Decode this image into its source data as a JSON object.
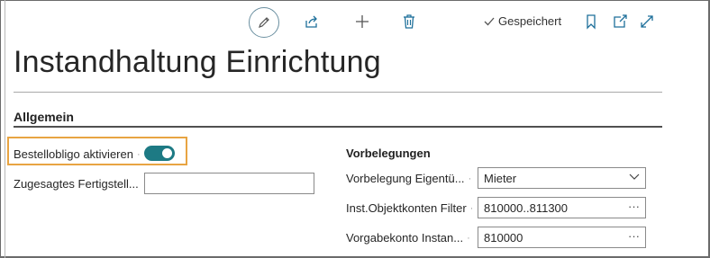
{
  "toolbar": {
    "edit_icon": "pencil-icon",
    "share_icon": "share-icon",
    "new_icon": "plus-icon",
    "delete_icon": "trash-icon",
    "saved_label": "Gespeichert",
    "bookmark_icon": "bookmark-icon",
    "open_new_icon": "open-in-new-window-icon",
    "expand_icon": "expand-icon"
  },
  "page": {
    "title": "Instandhaltung Einrichtung"
  },
  "section": {
    "title": "Allgemein"
  },
  "left_fields": {
    "bestellobligo": {
      "label": "Bestellobligo aktivieren",
      "value": true
    },
    "fertigstellung": {
      "label": "Zugesagtes Fertigstell...",
      "value": ""
    }
  },
  "right_fields": {
    "heading": "Vorbelegungen",
    "eigentuemer": {
      "label": "Vorbelegung Eigentü...",
      "value": "Mieter"
    },
    "objektkonten": {
      "label": "Inst.Objektkonten Filter",
      "value": "810000..811300"
    },
    "vorgabekonto": {
      "label": "Vorgabekonto Instan...",
      "value": "810000"
    }
  },
  "colors": {
    "accent": "#1d7a84",
    "highlight": "#e8a442"
  }
}
